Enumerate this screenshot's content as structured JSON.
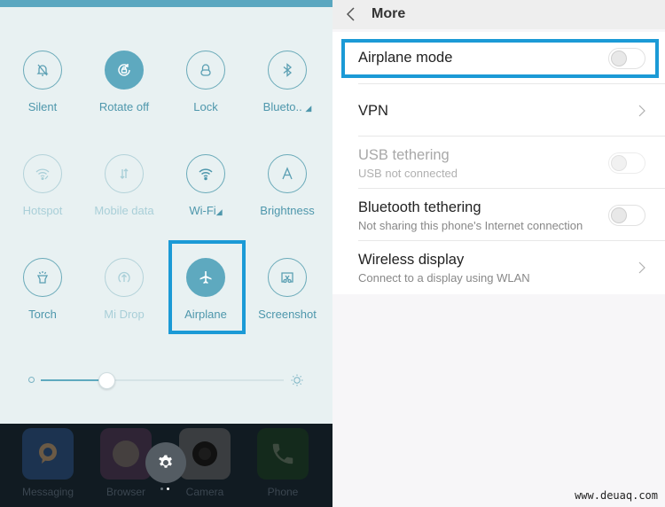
{
  "quick_settings": {
    "tiles": [
      {
        "label": "Silent",
        "icon": "bell-off-icon",
        "state": "off"
      },
      {
        "label": "Rotate off",
        "icon": "rotate-lock-icon",
        "state": "on"
      },
      {
        "label": "Lock",
        "icon": "lock-icon",
        "state": "off"
      },
      {
        "label": "Blueto..",
        "icon": "bluetooth-icon",
        "state": "off",
        "has_menu": true
      },
      {
        "label": "Hotspot",
        "icon": "hotspot-icon",
        "state": "disabled"
      },
      {
        "label": "Mobile data",
        "icon": "mobile-data-icon",
        "state": "disabled"
      },
      {
        "label": "Wi-Fi",
        "icon": "wifi-icon",
        "state": "off",
        "has_menu": true
      },
      {
        "label": "Brightness",
        "icon": "brightness-auto-icon",
        "state": "off"
      },
      {
        "label": "Torch",
        "icon": "torch-icon",
        "state": "off"
      },
      {
        "label": "Mi Drop",
        "icon": "mi-drop-icon",
        "state": "disabled"
      },
      {
        "label": "Airplane",
        "icon": "airplane-icon",
        "state": "on",
        "highlighted": true
      },
      {
        "label": "Screenshot",
        "icon": "screenshot-icon",
        "state": "off"
      }
    ],
    "brightness_level": 0.27
  },
  "dock": {
    "apps": [
      {
        "label": "Messaging",
        "color": "#1c3350"
      },
      {
        "label": "Browser",
        "color": "#2f2435"
      },
      {
        "label": "Camera",
        "color": "#3a3d40"
      },
      {
        "label": "Phone",
        "color": "#142a1c"
      }
    ],
    "page_indicator": {
      "pages": 2,
      "current": 2
    }
  },
  "settings": {
    "header": {
      "title": "More",
      "back_label": "Back"
    },
    "items": [
      {
        "title": "Airplane mode",
        "subtitle": "",
        "control": "toggle",
        "checked": false,
        "enabled": true,
        "highlighted": true
      },
      {
        "title": "VPN",
        "subtitle": "",
        "control": "chevron",
        "enabled": true
      },
      {
        "title": "USB tethering",
        "subtitle": "USB not connected",
        "control": "toggle",
        "checked": false,
        "enabled": false
      },
      {
        "title": "Bluetooth tethering",
        "subtitle": "Not sharing this phone's Internet connection",
        "control": "toggle",
        "checked": false,
        "enabled": true
      },
      {
        "title": "Wireless display",
        "subtitle": "Connect to a display using WLAN",
        "control": "chevron",
        "enabled": true
      }
    ]
  },
  "colors": {
    "accent": "#5ea9bf",
    "highlight_box": "#1b9ad6"
  },
  "watermark": "www.deuaq.com"
}
